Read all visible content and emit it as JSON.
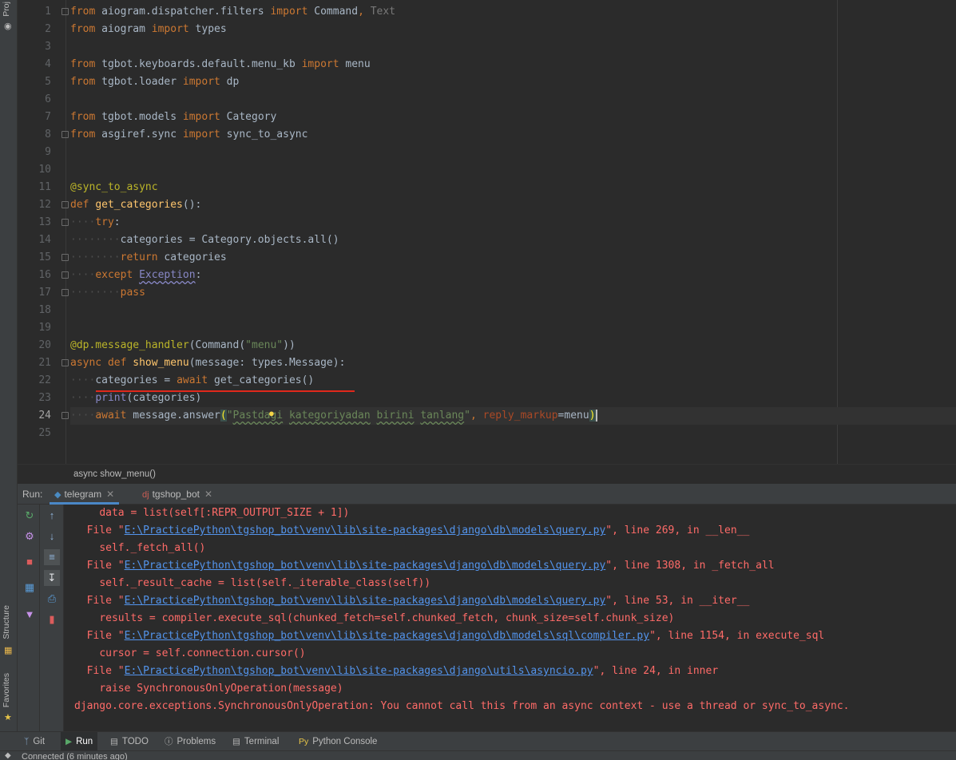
{
  "sidebar": {
    "project_label": "Proj",
    "structure_label": "Structure",
    "favorites_label": "Favorites"
  },
  "editor": {
    "line_numbers": [
      "1",
      "2",
      "3",
      "4",
      "5",
      "6",
      "7",
      "8",
      "9",
      "10",
      "11",
      "12",
      "13",
      "14",
      "15",
      "16",
      "17",
      "18",
      "19",
      "20",
      "21",
      "22",
      "23",
      "24",
      "25"
    ],
    "current_line": "24",
    "breadcrumb": "async show_menu()"
  },
  "run_panel": {
    "label": "Run:",
    "tabs": [
      {
        "label": "telegram",
        "icon": "python-icon",
        "active": true
      },
      {
        "label": "tgshop_bot",
        "icon": "django-icon",
        "active": false
      }
    ],
    "console_lines": [
      {
        "type": "code",
        "text": "data = list(self[:REPR_OUTPUT_SIZE + 1])"
      },
      {
        "type": "file",
        "prefix": "File \"",
        "path": "E:\\PracticePython\\tgshop_bot\\venv\\lib\\site-packages\\django\\db\\models\\query.py",
        "suffix": "\", line 269, in __len__"
      },
      {
        "type": "code",
        "text": "self._fetch_all()"
      },
      {
        "type": "file",
        "prefix": "File \"",
        "path": "E:\\PracticePython\\tgshop_bot\\venv\\lib\\site-packages\\django\\db\\models\\query.py",
        "suffix": "\", line 1308, in _fetch_all"
      },
      {
        "type": "code",
        "text": "self._result_cache = list(self._iterable_class(self))"
      },
      {
        "type": "file",
        "prefix": "File \"",
        "path": "E:\\PracticePython\\tgshop_bot\\venv\\lib\\site-packages\\django\\db\\models\\query.py",
        "suffix": "\", line 53, in __iter__"
      },
      {
        "type": "code",
        "text": "results = compiler.execute_sql(chunked_fetch=self.chunked_fetch, chunk_size=self.chunk_size)"
      },
      {
        "type": "file",
        "prefix": "File \"",
        "path": "E:\\PracticePython\\tgshop_bot\\venv\\lib\\site-packages\\django\\db\\models\\sql\\compiler.py",
        "suffix": "\", line 1154, in execute_sql"
      },
      {
        "type": "code",
        "text": "cursor = self.connection.cursor()"
      },
      {
        "type": "file",
        "prefix": "File \"",
        "path": "E:\\PracticePython\\tgshop_bot\\venv\\lib\\site-packages\\django\\utils\\asyncio.py",
        "suffix": "\", line 24, in inner"
      },
      {
        "type": "code",
        "text": "raise SynchronousOnlyOperation(message)"
      },
      {
        "type": "error",
        "text": "django.core.exceptions.SynchronousOnlyOperation: You cannot call this from an async context - use a thread or sync_to_async."
      }
    ]
  },
  "bottom_tabs": [
    {
      "label": "Git",
      "icon": "git-branch-icon"
    },
    {
      "label": "Run",
      "icon": "run-triangle-icon",
      "active": true
    },
    {
      "label": "TODO",
      "icon": "todo-icon"
    },
    {
      "label": "Problems",
      "icon": "info-icon"
    },
    {
      "label": "Terminal",
      "icon": "terminal-icon"
    },
    {
      "label": "Python Console",
      "icon": "python-console-icon"
    }
  ],
  "status_bar": {
    "text": "Connected (6 minutes ago)"
  },
  "colors": {
    "editor_bg": "#2b2b2b",
    "panel_bg": "#3c3f41",
    "keyword": "#cc7832",
    "string": "#6a8759",
    "function": "#ffc66d",
    "error_text": "#ff6b68",
    "link": "#5394ec",
    "error_underline": "#e0281b"
  }
}
